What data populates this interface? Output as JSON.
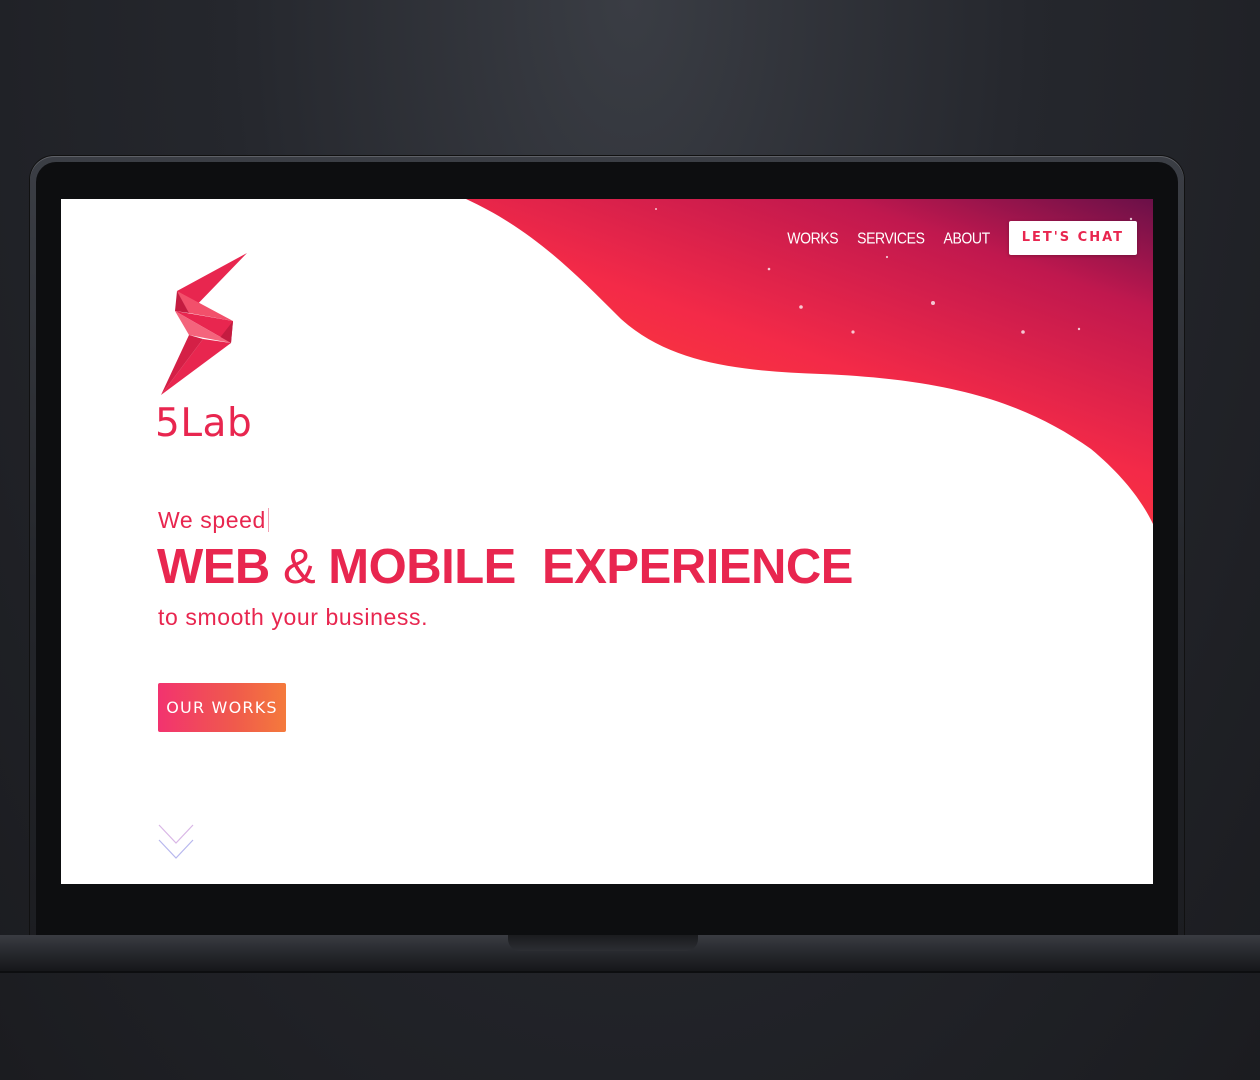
{
  "brand": {
    "name": "5Lab",
    "primary_color": "#e8264f",
    "gradient_colors": [
      "#f42c4c",
      "#7a1049"
    ],
    "logo_icon": "lightning-bolt-icon"
  },
  "nav": {
    "links": [
      "WORKS",
      "SERVICES",
      "ABOUT"
    ],
    "cta_label": "LET'S CHAT"
  },
  "hero": {
    "pre_text": "We speed",
    "title_part1": "WEB",
    "title_amp": "&",
    "title_part2": "MOBILE  EXPERIENCE",
    "subtitle": "to smooth your business.",
    "button_label": "OUR WORKS"
  },
  "scroll_indicator": {
    "icon": "chevron-down-icon"
  }
}
